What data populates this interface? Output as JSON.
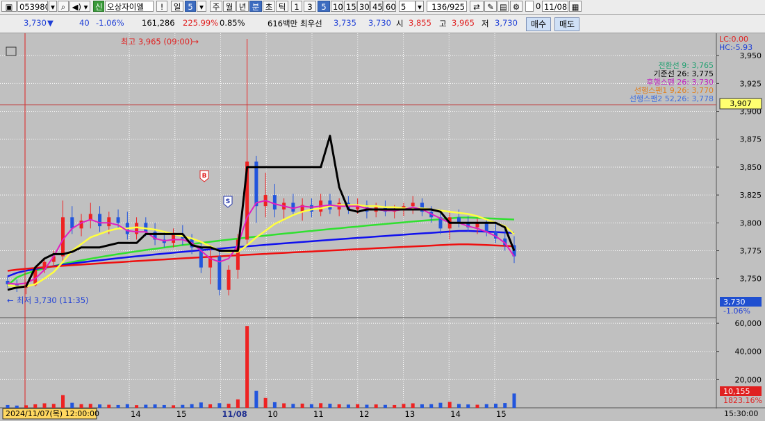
{
  "toolbar": {
    "stock_code": "053980",
    "market_badge": "신",
    "stock_name": "오상자이엘",
    "alert_label": "!",
    "period_day": "일",
    "period_num": "5",
    "period_week": "주",
    "period_month": "월",
    "period_year": "년",
    "period_minute": "분",
    "period_second": "초",
    "period_tick": "틱",
    "intervals": [
      "1",
      "3",
      "5",
      "10",
      "15",
      "30",
      "45",
      "60"
    ],
    "selected_interval": "5",
    "count_select": "5",
    "range_display": "136/925",
    "checkbox_value": "0",
    "date_value": "11/08"
  },
  "infobar": {
    "price": "3,730",
    "change": "40",
    "change_pct": "-1.06%",
    "volume": "161,286",
    "volume_ratio": "225.99%",
    "turnover": "0.85%",
    "amount": "616백만",
    "best_bid_label": "최우선",
    "best_ask": "3,735",
    "best_bid": "3,730",
    "open_label": "시",
    "open": "3,855",
    "high_label": "고",
    "high": "3,965",
    "low_label": "저",
    "low": "3,730",
    "buy_button": "매수",
    "sell_button": "매도"
  },
  "chart_labels": {
    "lc": "LC:0.00",
    "hc": "HC:-5.93",
    "high_annotation": "최고 3,965 (09:00)",
    "low_annotation": "최저 3,730 (11:35)",
    "crosshair_price": "3,907",
    "current_price_tag": "3,730",
    "current_change_tag": "-1.06%",
    "volume_tag": "10,155",
    "volume_pct_tag": "1823.16%",
    "cursor_date": "2024/11/07(목) 12:00:00",
    "end_time": "15:30:00",
    "buy_marker": "B",
    "sell_marker": "S"
  },
  "colors": {
    "up": "#ee2222",
    "down": "#2255dd",
    "ma5": "#e020c0",
    "ma20": "#ffff40",
    "ma60": "#30e030",
    "ma120": "#1010ee",
    "ma240": "#ee1010",
    "base_line": "#000000"
  },
  "chart_data": {
    "type": "line",
    "price_axis": {
      "ticks": [
        3750,
        3775,
        3800,
        3825,
        3850,
        3875,
        3900,
        3925,
        3950
      ],
      "range": [
        3715,
        3970
      ]
    },
    "volume_axis": {
      "ticks": [
        20000,
        40000,
        60000
      ],
      "range": [
        0,
        63000
      ]
    },
    "x_tick_labels": [
      "14",
      "15",
      "11/08",
      "10",
      "11",
      "12",
      "13",
      "14",
      "15"
    ],
    "legend": [
      {
        "name": "전환선 9",
        "value": "3,765",
        "color": "#20a070"
      },
      {
        "name": "기준선 26",
        "value": "3,775",
        "color": "#000000"
      },
      {
        "name": "후행스팬 26",
        "value": "3,730",
        "color": "#c020c0"
      },
      {
        "name": "선행스팬1 9,26",
        "value": "3,770",
        "color": "#e08020"
      },
      {
        "name": "선행스팬2 52,26",
        "value": "3,778",
        "color": "#4070e0"
      }
    ],
    "candles": [
      [
        3748,
        3752,
        3742,
        3745
      ],
      [
        3745,
        3749,
        3738,
        3742
      ],
      [
        3742,
        3747,
        3736,
        3744
      ],
      [
        3744,
        3760,
        3743,
        3758
      ],
      [
        3758,
        3768,
        3755,
        3765
      ],
      [
        3765,
        3775,
        3760,
        3770
      ],
      [
        3770,
        3820,
        3765,
        3805
      ],
      [
        3805,
        3815,
        3790,
        3795
      ],
      [
        3795,
        3808,
        3788,
        3802
      ],
      [
        3802,
        3818,
        3795,
        3808
      ],
      [
        3808,
        3815,
        3792,
        3797
      ],
      [
        3797,
        3810,
        3790,
        3805
      ],
      [
        3805,
        3812,
        3795,
        3800
      ],
      [
        3800,
        3810,
        3785,
        3790
      ],
      [
        3790,
        3805,
        3785,
        3800
      ],
      [
        3800,
        3805,
        3788,
        3792
      ],
      [
        3792,
        3800,
        3780,
        3785
      ],
      [
        3785,
        3792,
        3778,
        3782
      ],
      [
        3782,
        3795,
        3778,
        3790
      ],
      [
        3790,
        3798,
        3780,
        3786
      ],
      [
        3786,
        3790,
        3772,
        3778
      ],
      [
        3778,
        3782,
        3755,
        3760
      ],
      [
        3760,
        3780,
        3745,
        3770
      ],
      [
        3770,
        3775,
        3735,
        3740
      ],
      [
        3740,
        3762,
        3735,
        3758
      ],
      [
        3758,
        3790,
        3750,
        3785
      ],
      [
        3785,
        3965,
        3780,
        3855
      ],
      [
        3855,
        3860,
        3800,
        3815
      ],
      [
        3815,
        3845,
        3805,
        3825
      ],
      [
        3825,
        3835,
        3805,
        3812
      ],
      [
        3812,
        3822,
        3802,
        3818
      ],
      [
        3818,
        3826,
        3806,
        3810
      ],
      [
        3810,
        3822,
        3802,
        3816
      ],
      [
        3816,
        3822,
        3805,
        3810
      ],
      [
        3810,
        3826,
        3806,
        3820
      ],
      [
        3820,
        3826,
        3808,
        3812
      ],
      [
        3812,
        3822,
        3806,
        3818
      ],
      [
        3818,
        3824,
        3808,
        3812
      ],
      [
        3812,
        3822,
        3808,
        3816
      ],
      [
        3816,
        3820,
        3804,
        3810
      ],
      [
        3810,
        3818,
        3805,
        3814
      ],
      [
        3814,
        3820,
        3806,
        3810
      ],
      [
        3810,
        3816,
        3804,
        3812
      ],
      [
        3812,
        3818,
        3806,
        3815
      ],
      [
        3815,
        3824,
        3808,
        3818
      ],
      [
        3818,
        3822,
        3806,
        3810
      ],
      [
        3810,
        3815,
        3800,
        3805
      ],
      [
        3805,
        3812,
        3790,
        3795
      ],
      [
        3795,
        3810,
        3785,
        3805
      ],
      [
        3805,
        3812,
        3796,
        3800
      ],
      [
        3800,
        3806,
        3792,
        3796
      ],
      [
        3796,
        3804,
        3790,
        3800
      ],
      [
        3800,
        3804,
        3788,
        3792
      ],
      [
        3792,
        3800,
        3782,
        3786
      ],
      [
        3786,
        3795,
        3775,
        3780
      ],
      [
        3780,
        3788,
        3764,
        3770
      ]
    ],
    "volume": [
      2000,
      1600,
      1800,
      2500,
      3200,
      2800,
      9000,
      3600,
      2600,
      2800,
      2400,
      2200,
      2000,
      2600,
      1900,
      2200,
      2400,
      2000,
      1800,
      2100,
      2600,
      3800,
      2500,
      3300,
      2900,
      6000,
      58000,
      12000,
      7000,
      4000,
      3200,
      2800,
      3000,
      2600,
      3300,
      2900,
      2500,
      2300,
      2600,
      2200,
      2400,
      2100,
      2000,
      2800,
      3200,
      2500,
      2600,
      3600,
      4200,
      2700,
      2400,
      2200,
      2600,
      2900,
      3400,
      10155
    ],
    "ma_series": {
      "ma5": [
        3746,
        3745,
        3746,
        3750,
        3758,
        3770,
        3785,
        3795,
        3800,
        3803,
        3800,
        3800,
        3798,
        3793,
        3792,
        3792,
        3786,
        3784,
        3785,
        3785,
        3782,
        3775,
        3768,
        3765,
        3768,
        3780,
        3805,
        3818,
        3820,
        3817,
        3815,
        3813,
        3815,
        3814,
        3815,
        3816,
        3815,
        3815,
        3815,
        3813,
        3812,
        3811,
        3811,
        3812,
        3814,
        3812,
        3808,
        3804,
        3800,
        3800,
        3797,
        3795,
        3792,
        3788,
        3782,
        3770
      ],
      "ma20": [
        3744,
        3743,
        3743,
        3745,
        3750,
        3756,
        3765,
        3775,
        3781,
        3787,
        3790,
        3793,
        3795,
        3795,
        3796,
        3795,
        3794,
        3792,
        3790,
        3788,
        3786,
        3783,
        3779,
        3775,
        3774,
        3774,
        3780,
        3787,
        3793,
        3799,
        3803,
        3807,
        3810,
        3812,
        3813,
        3815,
        3816,
        3816,
        3816,
        3815,
        3815,
        3814,
        3814,
        3813,
        3813,
        3813,
        3812,
        3811,
        3810,
        3809,
        3808,
        3806,
        3803,
        3800,
        3797,
        3790
      ]
    },
    "baseline_series": [
      3740,
      3742,
      3743,
      3760,
      3768,
      3772,
      3772,
      3774,
      3778,
      3778,
      3778,
      3780,
      3782,
      3782,
      3782,
      3790,
      3790,
      3790,
      3790,
      3790,
      3780,
      3778,
      3778,
      3775,
      3775,
      3775,
      3850,
      3850,
      3850,
      3850,
      3850,
      3850,
      3850,
      3850,
      3850,
      3878,
      3832,
      3812,
      3810,
      3812,
      3812,
      3812,
      3812,
      3812,
      3812,
      3812,
      3812,
      3810,
      3800,
      3800,
      3800,
      3800,
      3800,
      3800,
      3796,
      3775
    ],
    "ma60_range": [
      3744,
      3805
    ],
    "ma120_range": [
      3752,
      3793
    ],
    "ma240_range": [
      3757,
      3781
    ]
  }
}
